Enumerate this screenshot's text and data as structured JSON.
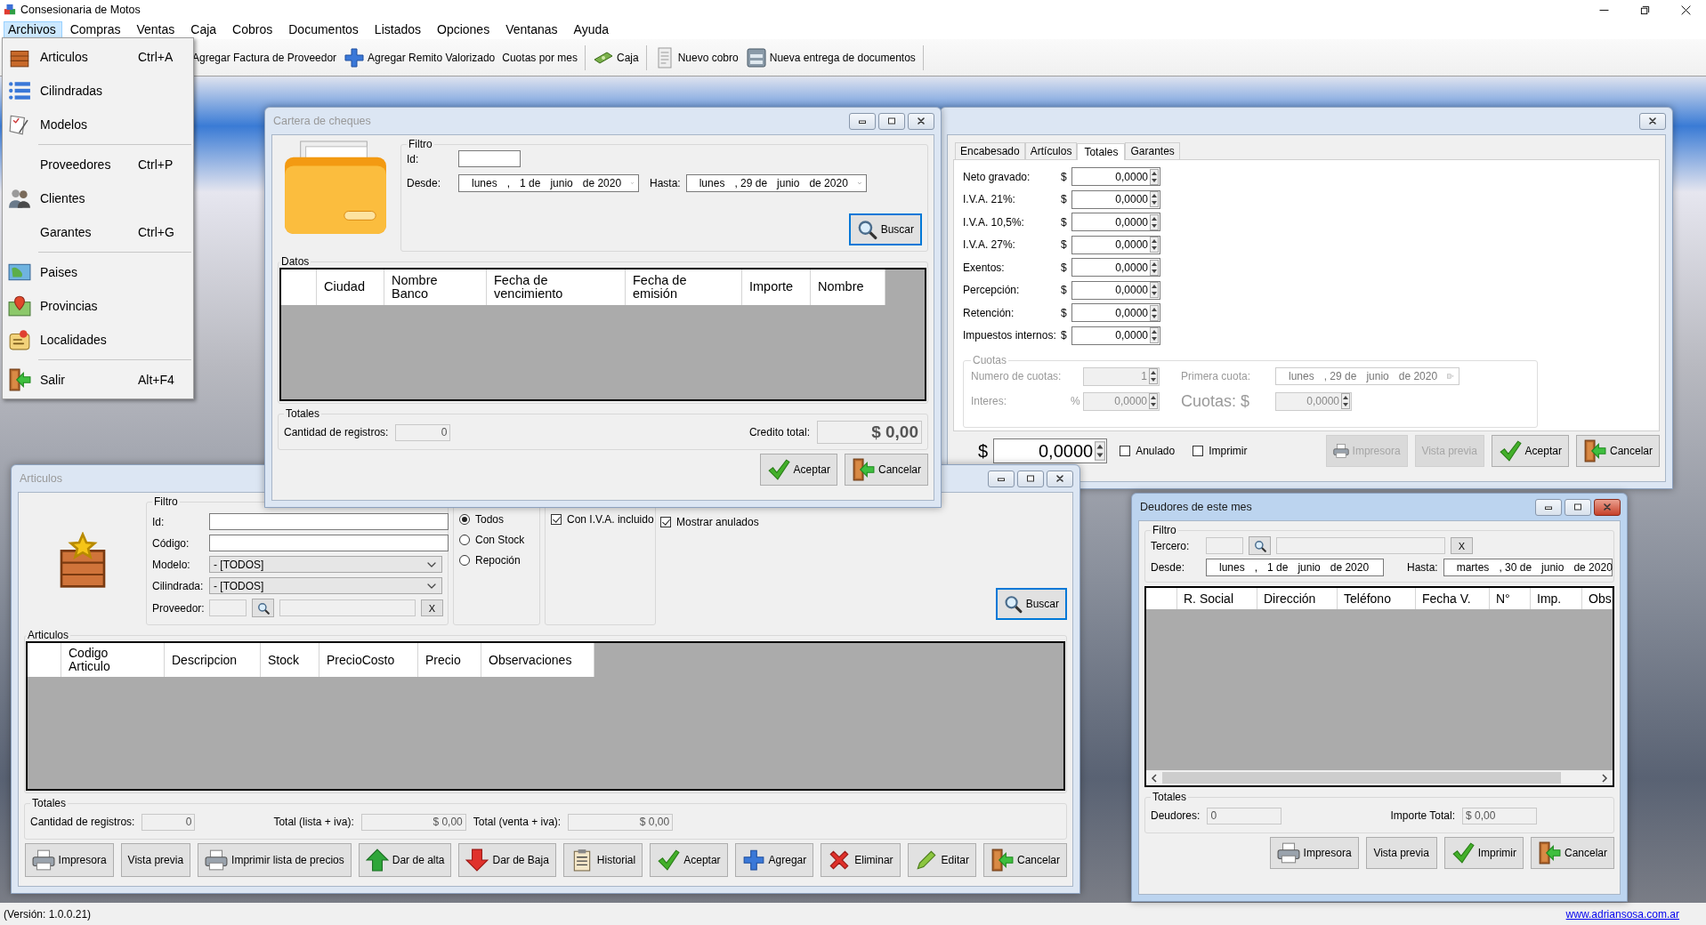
{
  "app": {
    "title": "Consesionaria de Motos"
  },
  "menu": [
    {
      "label": "Archivos",
      "selected": true
    },
    {
      "label": "Compras",
      "selected": false
    },
    {
      "label": "Ventas",
      "selected": false
    },
    {
      "label": "Caja",
      "selected": false
    },
    {
      "label": "Cobros",
      "selected": false
    },
    {
      "label": "Documentos",
      "selected": false
    },
    {
      "label": "Listados",
      "selected": false
    },
    {
      "label": "Opciones",
      "selected": false
    },
    {
      "label": "Ventanas",
      "selected": false
    },
    {
      "label": "Ayuda",
      "selected": false
    }
  ],
  "archivos_menu": [
    [
      {
        "label": "Articulos",
        "shortcut": "Ctrl+A"
      },
      {
        "label": "Cilindradas"
      },
      {
        "label": "Modelos"
      }
    ],
    [
      {
        "label": "Proveedores",
        "shortcut": "Ctrl+P"
      },
      {
        "label": "Clientes"
      },
      {
        "label": "Garantes",
        "shortcut": "Ctrl+G"
      }
    ],
    [
      {
        "label": "Paises"
      },
      {
        "label": "Provincias"
      },
      {
        "label": "Localidades"
      }
    ],
    [
      {
        "label": "Salir",
        "shortcut": "Alt+F4"
      }
    ]
  ],
  "toolbar": [
    [
      "Agregar Factura de Proveedor",
      "Agregar Remito Valorizado",
      "Cuotas por mes"
    ],
    [
      "Caja"
    ],
    [
      "Nuevo cobro",
      "Nueva entrega de documentos"
    ]
  ],
  "cheques_window": {
    "title": "Cartera de cheques",
    "active": false,
    "filter": {
      "legend": "Filtro",
      "id_label": "Id:",
      "desde_label": "Desde:",
      "desde": [
        "lunes",
        ",",
        "1 de",
        "junio",
        "de 2020"
      ],
      "hasta_label": "Hasta:",
      "hasta": [
        "lunes",
        ", 29 de",
        "junio",
        "de 2020"
      ],
      "search_button": {
        "label": "Buscar",
        "kind": "search"
      }
    },
    "grid": {
      "legend": "Datos",
      "columns": [
        "Ciudad",
        "Nombre Banco",
        "Fecha de vencimiento",
        "Fecha de emisión",
        "Importe",
        "Nombre"
      ]
    },
    "totals": {
      "legend": "Totales",
      "count_label": "Cantidad de registros:",
      "count": "0",
      "credit_label": "Credito total:",
      "credit": "$ 0,00"
    },
    "buttons": [
      {
        "label": "Aceptar",
        "kind": "accept"
      },
      {
        "label": "Cancelar",
        "kind": "cancel"
      }
    ]
  },
  "totales_window": {
    "tabs": [
      {
        "label": "Encabesado",
        "selected": false
      },
      {
        "label": "Artículos",
        "selected": false
      },
      {
        "label": "Totales",
        "selected": true
      },
      {
        "label": "Garantes",
        "selected": false
      }
    ],
    "amounts": [
      {
        "label": "Neto gravado:",
        "currency": "$",
        "value": "0,0000"
      },
      {
        "label": "I.V.A. 21%:",
        "currency": "$",
        "value": "0,0000"
      },
      {
        "label": "I.V.A. 10,5%:",
        "currency": "$",
        "value": "0,0000"
      },
      {
        "label": "I.V.A. 27%:",
        "currency": "$",
        "value": "0,0000"
      },
      {
        "label": "Exentos:",
        "currency": "$",
        "value": "0,0000"
      },
      {
        "label": "Percepción:",
        "currency": "$",
        "value": "0,0000"
      },
      {
        "label": "Retención:",
        "currency": "$",
        "value": "0,0000"
      },
      {
        "label": "Impuestos internos:",
        "currency": "$",
        "value": "0,0000"
      }
    ],
    "cuotas": {
      "legend": "Cuotas",
      "disabled": true,
      "count_label": "Numero de cuotas:",
      "count": "1",
      "first_label": "Primera cuota:",
      "first_date": [
        "lunes",
        ", 29 de",
        "junio",
        "de 2020"
      ],
      "interest_label": "Interes:",
      "percent": "%",
      "interest": "0,0000",
      "cuotas_label": "Cuotas: $",
      "cuotas_value": "0,0000"
    },
    "total": {
      "currency": "$",
      "value": "0,0000"
    },
    "checks": [
      {
        "label": "Anulado",
        "checked": false
      },
      {
        "label": "Imprimir",
        "checked": false
      }
    ],
    "buttons": [
      {
        "label": "Impresora",
        "kind": "print",
        "disabled": true
      },
      {
        "label": "Vista previa",
        "kind": "plain",
        "disabled": true
      },
      {
        "label": "Aceptar",
        "kind": "accept",
        "disabled": false
      },
      {
        "label": "Cancelar",
        "kind": "cancel",
        "disabled": false
      }
    ]
  },
  "articulos_window": {
    "title": "Articulos",
    "active": false,
    "filter": {
      "legend": "Filtro",
      "id_label": "Id:",
      "code_label": "Código:",
      "model_label": "Modelo:",
      "model": "- [TODOS]",
      "cyl_label": "Cilindrada:",
      "cyl": "- [TODOS]",
      "supplier_label": "Proveedor:",
      "clear": "X"
    },
    "stock": [
      {
        "label": "Todos",
        "selected": true
      },
      {
        "label": "Con Stock",
        "selected": false
      },
      {
        "label": "Repoción",
        "selected": false
      }
    ],
    "price_checks": [
      {
        "label": "Con I.V.A. incluido",
        "checked": true
      }
    ],
    "show_voided": {
      "label": "Mostrar anulados",
      "checked": true
    },
    "search_button": {
      "label": "Buscar",
      "kind": "search"
    },
    "grid": {
      "legend": "Articulos",
      "columns": [
        "Codigo Articulo",
        "Descripcion",
        "Stock",
        "PrecioCosto",
        "Precio",
        "Observaciones"
      ]
    },
    "totals": {
      "legend": "Totales",
      "fields": [
        {
          "label": "Cantidad de registros:",
          "value": "0"
        },
        {
          "label": "Total (lista + iva):",
          "value": "$ 0,00"
        },
        {
          "label": "Total (venta + iva):",
          "value": "$ 0,00"
        }
      ]
    },
    "buttons": [
      {
        "label": "Impresora",
        "kind": "print"
      },
      {
        "label": "Vista previa",
        "kind": "plain"
      },
      {
        "label": "Imprimir lista de precios",
        "kind": "print"
      },
      {
        "label": "Dar de alta",
        "kind": "up"
      },
      {
        "label": "Dar de Baja",
        "kind": "down"
      },
      {
        "label": "Historial",
        "kind": "list"
      },
      {
        "label": "Aceptar",
        "kind": "accept"
      },
      {
        "label": "Agregar",
        "kind": "add"
      },
      {
        "label": "Eliminar",
        "kind": "delete"
      },
      {
        "label": "Editar",
        "kind": "edit"
      },
      {
        "label": "Cancelar",
        "kind": "cancel"
      }
    ]
  },
  "deudores_window": {
    "title": "Deudores de este mes",
    "active": true,
    "filter": {
      "legend": "Filtro",
      "tercero_label": "Tercero:",
      "clear": "X",
      "desde_label": "Desde:",
      "desde": [
        "lunes",
        ",",
        "1 de",
        "junio",
        "de 2020"
      ],
      "hasta_label": "Hasta:",
      "hasta": [
        "martes",
        ", 30 de",
        "junio",
        "de 2020"
      ]
    },
    "grid": {
      "columns": [
        "R. Social",
        "Dirección",
        "Teléfono",
        "Fecha V.",
        "N°",
        "Imp.",
        "Obs"
      ]
    },
    "totals": {
      "legend": "Totales",
      "count_label": "Deudores:",
      "count": "0",
      "amount_label": "Importe Total:",
      "amount": "$ 0,00"
    },
    "buttons": [
      {
        "label": "Impresora",
        "kind": "print"
      },
      {
        "label": "Vista previa",
        "kind": "plain"
      },
      {
        "label": "Imprimir",
        "kind": "accept"
      },
      {
        "label": "Cancelar",
        "kind": "cancel"
      }
    ]
  },
  "status_bar": {
    "version": "(Versión: 1.0.0.21)",
    "link": "www.adriansosa.com.ar"
  }
}
